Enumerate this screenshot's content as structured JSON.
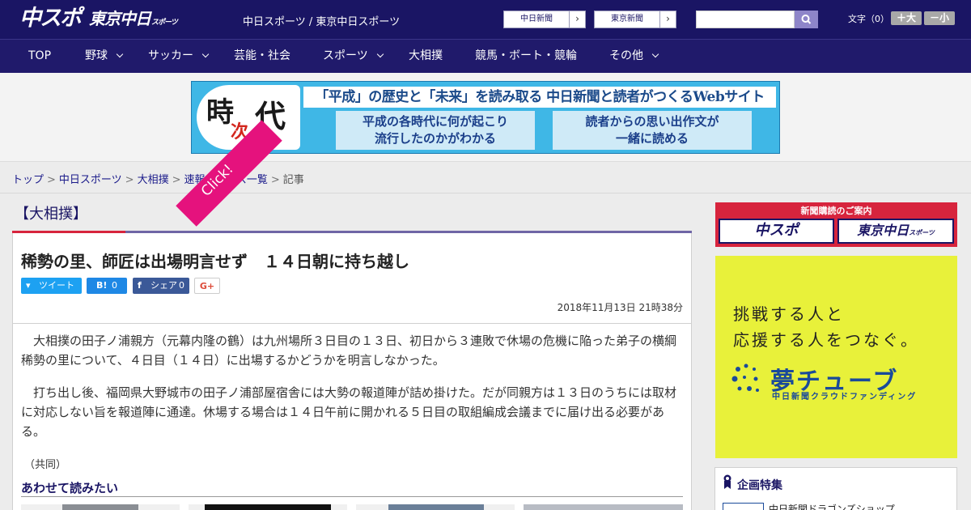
{
  "header": {
    "logo_chuspo": "中スポ",
    "logo_tokyo": "東京中日",
    "logo_tokyo_small": "スポーツ",
    "title": "中日スポーツ / 東京中日スポーツ",
    "chunichi_btn": "中日新聞",
    "tokyo_btn": "東京新聞",
    "search_placeholder": "",
    "font_label": "文字（0）",
    "font_plus": "＋大",
    "font_minus": "－小"
  },
  "nav": {
    "items": [
      "TOP",
      "野球",
      "サッカー",
      "芸能・社会",
      "スポーツ",
      "大相撲",
      "競馬・ボート・競輪",
      "その他"
    ]
  },
  "banner": {
    "logo_chars": [
      "時",
      "次",
      "代"
    ],
    "headline": "「平成」の歴史と「未来」を読み取る 中日新聞と読者がつくるWebサイト",
    "box1": [
      "平成の各時代に何が起こり",
      "流行したのかがわかる"
    ],
    "box2": [
      "読者からの思い出作文が",
      "一緒に読める"
    ]
  },
  "breadcrumb": {
    "items": [
      "トップ",
      "中日スポーツ",
      "大相撲",
      "速報ニュース一覧"
    ],
    "current": "記事"
  },
  "article": {
    "category": "【大相撲】",
    "title": "稀勢の里、師匠は出場明言せず　１４日朝に持ち越し",
    "share": {
      "tweet": "ツイート",
      "hatena": "0",
      "fb_label": "シェア",
      "fb_count": "0",
      "gplus": "G+"
    },
    "date": "2018年11月13日 21時38分",
    "paragraphs": [
      "大相撲の田子ノ浦親方（元幕内隆の鶴）は九州場所３日目の１３日、初日から３連敗で休場の危機に陥った弟子の横綱稀勢の里について、４日目（１４日）に出場するかどうかを明言しなかった。",
      "打ち出し後、福岡県大野城市の田子ノ浦部屋宿舎には大勢の報道陣が詰め掛けた。だが同親方は１３日のうちには取材に対応しない旨を報道陣に通達。休場する場合は１４日午前に開かれる５日目の取組編成会議までに届け出る必要がある。"
    ],
    "source": "（共同）",
    "related_title": "あわせて読みたい"
  },
  "sidebar": {
    "subscribe_label": "新聞購読のご案内",
    "sub_logo1": "中スポ",
    "sub_logo2": "東京中日",
    "sub_logo2_small": "スポーツ",
    "yume_line1": "挑戦する人と",
    "yume_line2": "応援する人をつなぐ。",
    "yume_logo": "夢チューブ",
    "yume_sub": "中日新聞クラウドファンディング",
    "yume_click": "Click!",
    "feature_title": "企画特集",
    "feature_item": "中日新聞ドラゴンズショップ"
  },
  "colors": {
    "brand_navy": "#1a1564",
    "accent_red": "#d7243d",
    "yume_yellow": "#e8f13a"
  }
}
